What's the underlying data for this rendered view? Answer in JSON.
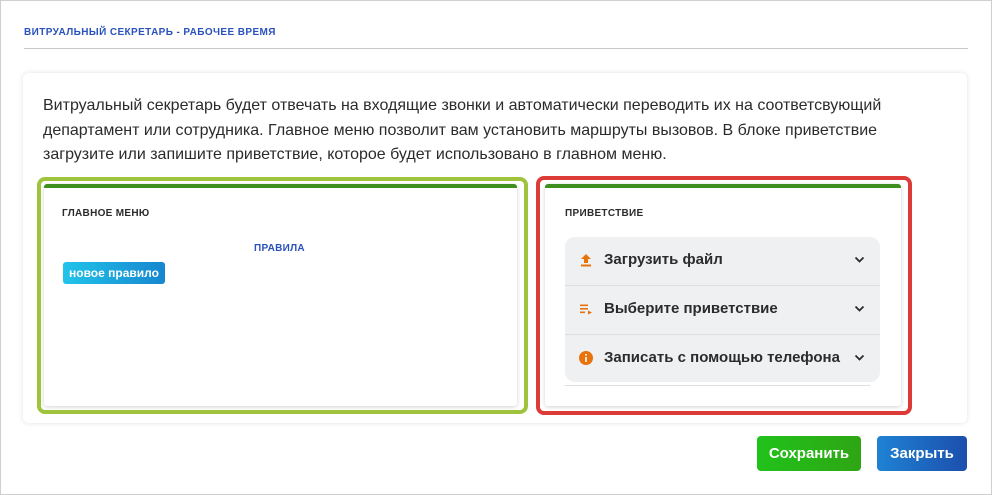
{
  "modal": {
    "title": "ВИТРУАЛЬНЫЙ СЕКРЕТАРЬ - РАБОЧЕЕ ВРЕМЯ",
    "description": "Витруальный секретарь будет отвечать на входящие звонки и автоматически переводить их на соответсвующий департамент или сотрудника. Главное меню позволит вам установить маршруты вызовов. В блоке приветствие загрузите или запишите приветствие, которое будет использовано в главном меню."
  },
  "main_menu": {
    "title": "ГЛАВНОЕ МЕНЮ",
    "rules_label": "ПРАВИЛА",
    "new_rule_button": "новое правило"
  },
  "greeting": {
    "title": "ПРИВЕТСТВИЕ",
    "items": [
      {
        "label": "Загрузить файл",
        "icon": "upload-icon"
      },
      {
        "label": "Выберите приветствие",
        "icon": "playlist-icon"
      },
      {
        "label": "Записать с помощью телефона",
        "icon": "info-icon"
      }
    ]
  },
  "footer": {
    "save_label": "Сохранить",
    "close_label": "Закрыть"
  },
  "colors": {
    "accent_blue": "#2a52be",
    "icon_orange": "#e8720c",
    "highlight_green": "#9fc33d",
    "highlight_red": "#dd3b37",
    "save_green": "#2ea614",
    "close_blue": "#1b4fad"
  }
}
